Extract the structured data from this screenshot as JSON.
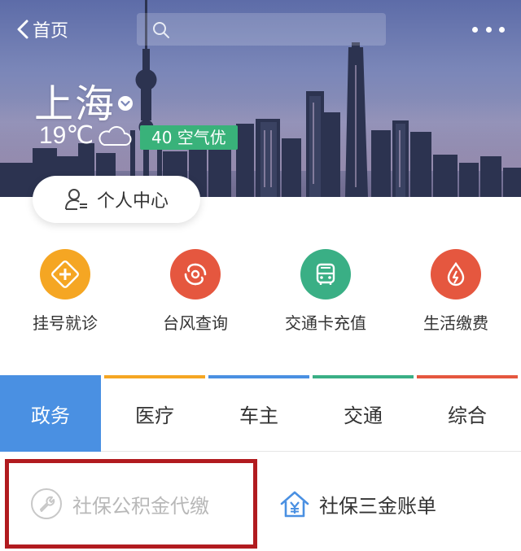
{
  "header": {
    "back_label": "首页",
    "search_icon": "search-icon",
    "more_icon": "more-icon"
  },
  "weather": {
    "city": "上海",
    "temperature": "19℃",
    "aqi_badge": "40 空气优",
    "aqi_color": "#39b27a"
  },
  "profile": {
    "label": "个人中心",
    "icon": "user-list-icon"
  },
  "services": [
    {
      "label": "挂号就诊",
      "icon": "medical-cross-icon",
      "color": "#f5a623"
    },
    {
      "label": "台风查询",
      "icon": "typhoon-icon",
      "color": "#e5573f"
    },
    {
      "label": "交通卡充值",
      "icon": "bus-icon",
      "color": "#3aaf85"
    },
    {
      "label": "生活缴费",
      "icon": "water-drop-icon",
      "color": "#e5573f"
    }
  ],
  "tabs": [
    {
      "label": "政务",
      "active": true,
      "accent": "#4a90e2"
    },
    {
      "label": "医疗",
      "active": false,
      "accent": "#f5a623"
    },
    {
      "label": "车主",
      "active": false,
      "accent": "#4a90e2"
    },
    {
      "label": "交通",
      "active": false,
      "accent": "#3aaf85"
    },
    {
      "label": "综合",
      "active": false,
      "accent": "#e5573f"
    }
  ],
  "list": {
    "item_a": {
      "label": "社保公积金代缴",
      "icon": "wrench-icon"
    },
    "item_b": {
      "label": "社保三金账单",
      "icon": "yen-house-icon"
    }
  }
}
